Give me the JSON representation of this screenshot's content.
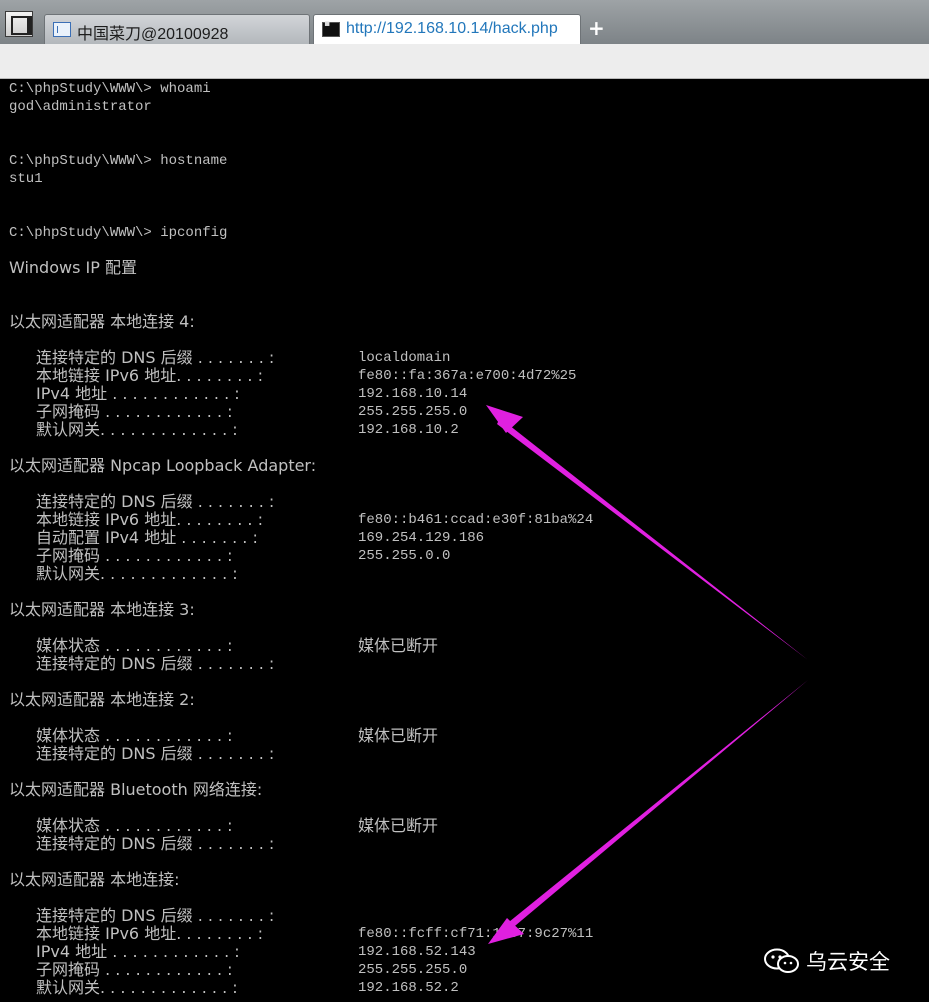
{
  "browser": {
    "tabs": [
      {
        "label": "中国菜刀@20100928"
      },
      {
        "label": "http://192.168.10.14/hack.php"
      }
    ],
    "new_tab": "+"
  },
  "console": {
    "cmd1": "C:\\phpStudy\\WWW\\> whoami",
    "out1": "god\\administrator",
    "cmd2": "C:\\phpStudy\\WWW\\> hostname",
    "out2": "stu1",
    "cmd3": "C:\\phpStudy\\WWW\\> ipconfig",
    "title": "Windows IP 配置",
    "a1": {
      "header": "以太网适配器 本地连接 4:",
      "rows": [
        {
          "k": "连接特定的 DNS 后缀 . . . . . . . :",
          "v": "localdomain"
        },
        {
          "k": "本地链接 IPv6 地址. . . . . . . . :",
          "v": "fe80::fa:367a:e700:4d72%25"
        },
        {
          "k": "IPv4 地址 . . . . . . . . . . . . :",
          "v": "192.168.10.14"
        },
        {
          "k": "子网掩码 . . . . . . . . . . . . :",
          "v": "255.255.255.0"
        },
        {
          "k": "默认网关. . . . . . . . . . . . . :",
          "v": "192.168.10.2"
        }
      ]
    },
    "a2": {
      "header": "以太网适配器 Npcap Loopback Adapter:",
      "rows": [
        {
          "k": "连接特定的 DNS 后缀 . . . . . . . :",
          "v": ""
        },
        {
          "k": "本地链接 IPv6 地址. . . . . . . . :",
          "v": "fe80::b461:ccad:e30f:81ba%24"
        },
        {
          "k": "自动配置 IPv4 地址 . . . . . . . :",
          "v": "169.254.129.186"
        },
        {
          "k": "子网掩码 . . . . . . . . . . . . :",
          "v": "255.255.0.0"
        },
        {
          "k": "默认网关. . . . . . . . . . . . . :",
          "v": ""
        }
      ]
    },
    "a3": {
      "header": "以太网适配器 本地连接 3:",
      "rows": [
        {
          "k": "媒体状态 . . . . . . . . . . . . :",
          "v": "媒体已断开"
        },
        {
          "k": "连接特定的 DNS 后缀 . . . . . . . :",
          "v": ""
        }
      ]
    },
    "a4": {
      "header": "以太网适配器 本地连接 2:",
      "rows": [
        {
          "k": "媒体状态 . . . . . . . . . . . . :",
          "v": "媒体已断开"
        },
        {
          "k": "连接特定的 DNS 后缀 . . . . . . . :",
          "v": ""
        }
      ]
    },
    "a5": {
      "header": "以太网适配器 Bluetooth 网络连接:",
      "rows": [
        {
          "k": "媒体状态 . . . . . . . . . . . . :",
          "v": "媒体已断开"
        },
        {
          "k": "连接特定的 DNS 后缀 . . . . . . . :",
          "v": ""
        }
      ]
    },
    "a6": {
      "header": "以太网适配器 本地连接:",
      "rows": [
        {
          "k": "连接特定的 DNS 后缀 . . . . . . . :",
          "v": ""
        },
        {
          "k": "本地链接 IPv6 地址. . . . . . . . :",
          "v": "fe80::fcff:cf71:1487:9c27%11"
        },
        {
          "k": "IPv4 地址 . . . . . . . . . . . . :",
          "v": "192.168.52.143"
        },
        {
          "k": "子网掩码 . . . . . . . . . . . . :",
          "v": "255.255.255.0"
        },
        {
          "k": "默认网关. . . . . . . . . . . . . :",
          "v": "192.168.52.2"
        }
      ]
    }
  },
  "annotation": {
    "arrow_color": "#e020e0"
  },
  "watermark": {
    "text": "乌云安全",
    "icon": "wechat-icon"
  }
}
